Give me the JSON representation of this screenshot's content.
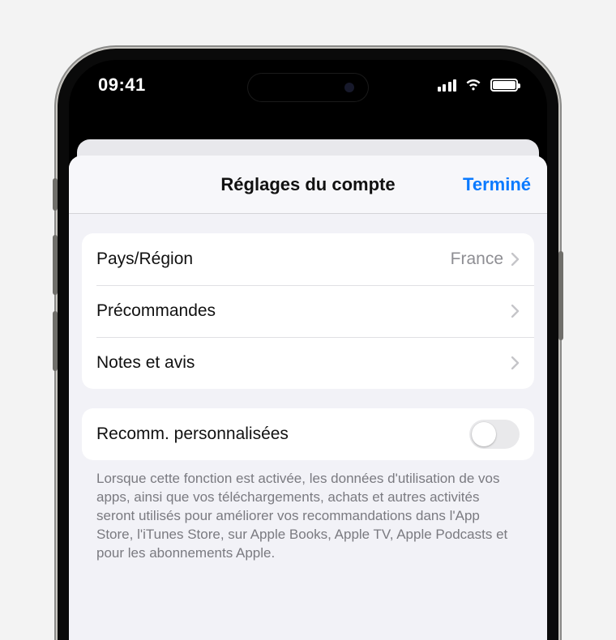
{
  "status": {
    "time": "09:41"
  },
  "sheet": {
    "title": "Réglages du compte",
    "done": "Terminé"
  },
  "rows": {
    "country": {
      "label": "Pays/Région",
      "value": "France"
    },
    "preorders": {
      "label": "Précommandes"
    },
    "ratings": {
      "label": "Notes et avis"
    }
  },
  "toggle": {
    "label": "Recomm. personnalisées",
    "on": false
  },
  "footer": "Lorsque cette fonction est activée, les données d'utilisation de vos apps, ainsi que vos téléchargements, achats et autres activités seront utilisés pour améliorer vos recommandations dans l'App Store, l'iTunes Store, sur Apple Books, Apple TV, Apple Podcasts et pour les abonnements Apple."
}
